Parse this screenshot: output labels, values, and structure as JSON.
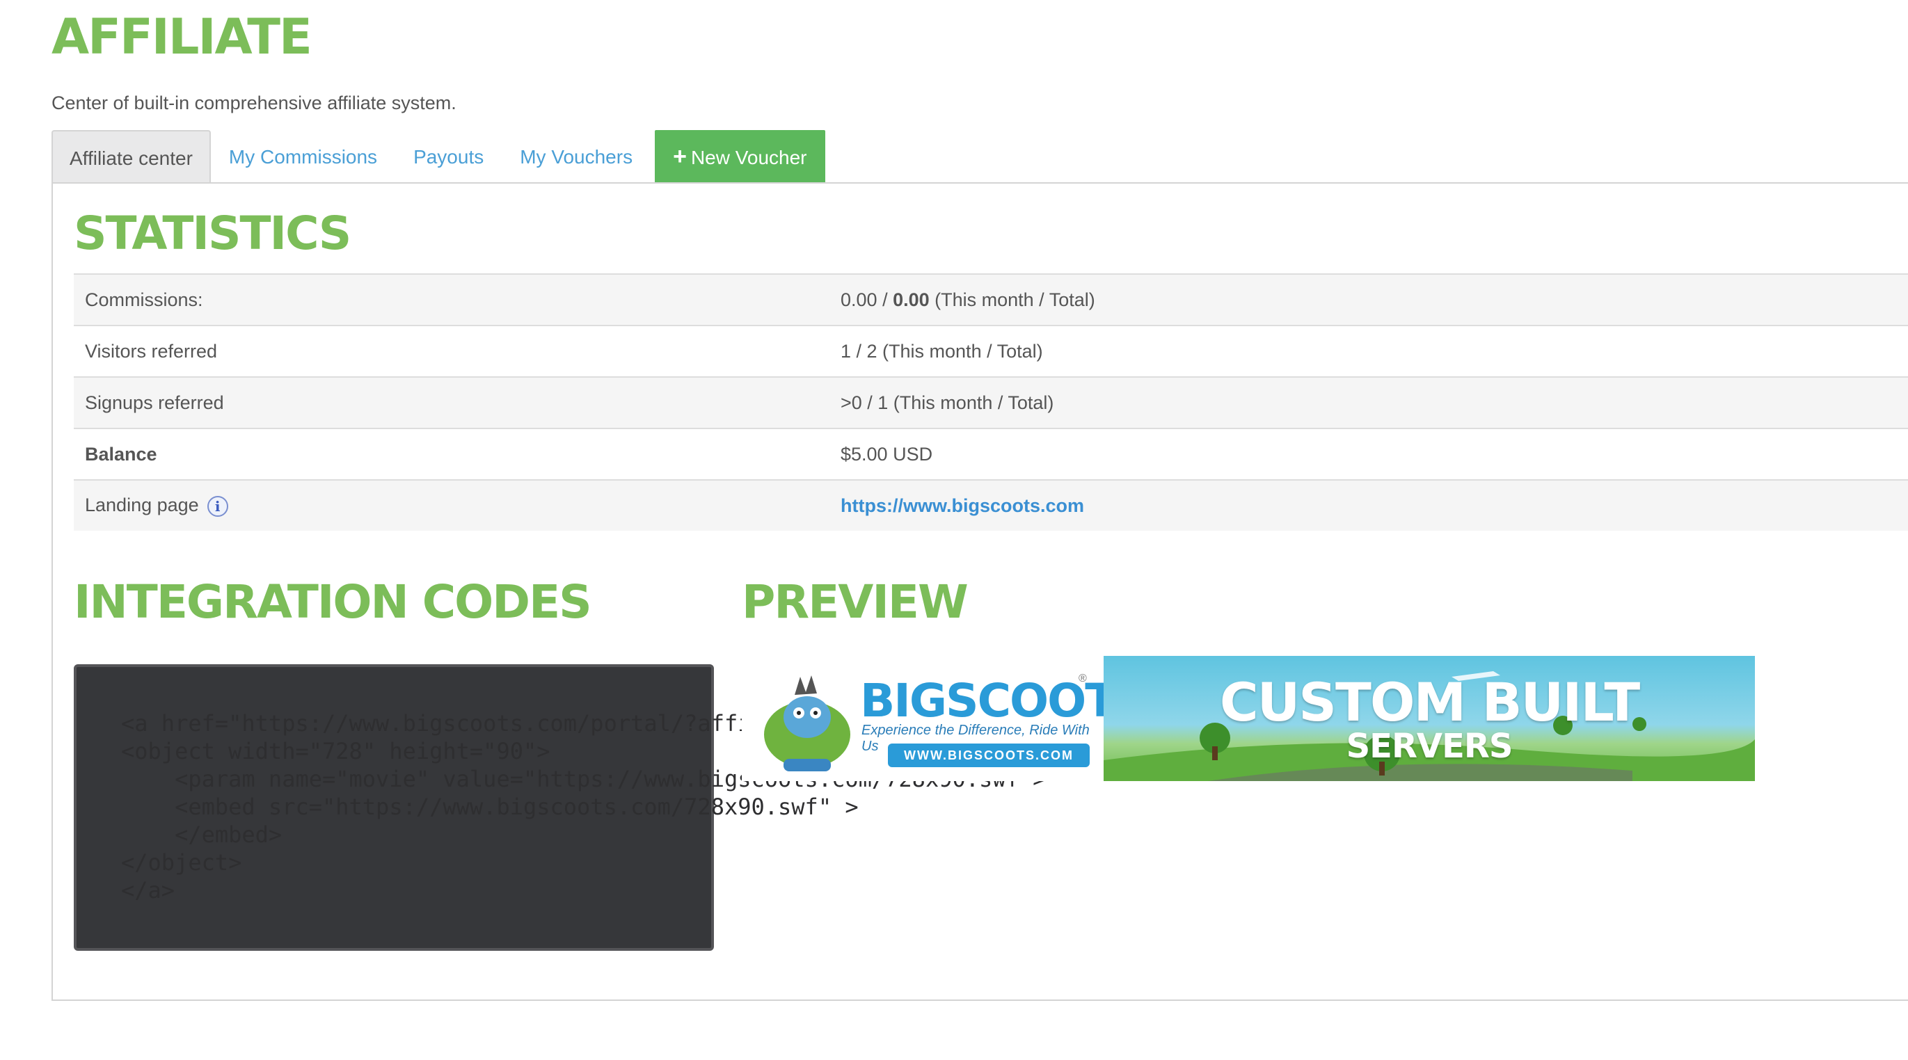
{
  "page": {
    "title": "AFFILIATE",
    "description": "Center of built-in comprehensive affiliate system."
  },
  "tabs": [
    {
      "label": "Affiliate center"
    },
    {
      "label": "My Commissions"
    },
    {
      "label": "Payouts"
    },
    {
      "label": "My Vouchers"
    },
    {
      "label": "New Voucher",
      "icon": "plus-icon"
    }
  ],
  "statistics": {
    "title": "STATISTICS",
    "rows": [
      {
        "label": "Commissions:",
        "value_month": "0.00",
        "separator": " / ",
        "value_total": "0.00",
        "suffix": " (This month / Total)"
      },
      {
        "label": "Visitors referred",
        "value": "1 / 2 (This month / Total)"
      },
      {
        "label": "Signups referred",
        "value": ">0 / 1 (This month / Total)"
      },
      {
        "label": "Balance",
        "value": "$5.00 USD"
      },
      {
        "label": "Landing page",
        "info_icon": "i",
        "value": "https://www.bigscoots.com"
      }
    ]
  },
  "integration": {
    "title": "INTEGRATION CODES",
    "code_lines": [
      "<a href=\"https://www.bigscoots.com/portal/?affic",
      "<object width=\"728\" height=\"90\">",
      "    <param name=\"movie\" value=\"https://www.bigscoots.com/728x90.swf\">",
      "    <embed src=\"https://www.bigscoots.com/728x90.swf\" >",
      "    </embed>",
      "</object>",
      "</a>"
    ]
  },
  "preview": {
    "title": "PREVIEW",
    "brand_name": "BIGSCOOTS",
    "brand_reg": "®",
    "brand_tagline": "Experience the Difference, Ride With Us",
    "brand_url": "WWW.BIGSCOOTS.COM",
    "headline_1": "CUSTOM BUILT",
    "headline_2": "SERVERS"
  },
  "colors": {
    "heading_green": "#7cbd59",
    "link_blue": "#4a9fd6",
    "button_green": "#5cb85c",
    "code_bg": "#36373a"
  }
}
